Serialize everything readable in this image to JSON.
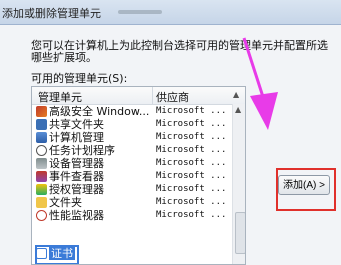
{
  "window": {
    "title": "添加或删除管理单元"
  },
  "description": {
    "line1": "您可以在计算机上为此控制台选择可用的管理单元并配置所选",
    "line2": "哪些扩展项。"
  },
  "available_label": "可用的管理单元(S):",
  "table": {
    "columns": [
      "管理单元",
      "供应商"
    ],
    "rows": [
      {
        "name": "高级安全 Window...",
        "vendor": "Microsoft ...",
        "icon": "firewall-icon"
      },
      {
        "name": "共享文件夹",
        "vendor": "Microsoft ...",
        "icon": "shared-folder-icon"
      },
      {
        "name": "计算机管理",
        "vendor": "Microsoft ...",
        "icon": "computer-management-icon"
      },
      {
        "name": "任务计划程序",
        "vendor": "Microsoft ...",
        "icon": "clock-icon"
      },
      {
        "name": "设备管理器",
        "vendor": "Microsoft ...",
        "icon": "device-manager-icon"
      },
      {
        "name": "事件查看器",
        "vendor": "Microsoft ...",
        "icon": "event-viewer-icon"
      },
      {
        "name": "授权管理器",
        "vendor": "Microsoft ...",
        "icon": "authorization-icon"
      },
      {
        "name": "文件夹",
        "vendor": "Microsoft ...",
        "icon": "folder-icon"
      },
      {
        "name": "性能监视器",
        "vendor": "Microsoft ...",
        "icon": "performance-icon"
      },
      {
        "name": "证书",
        "vendor": "",
        "icon": "certificate-icon",
        "selected": true
      }
    ]
  },
  "add_button": {
    "label": "添加(A) >"
  },
  "colors": {
    "highlight_red": "#e0302b",
    "arrow_magenta": "#e83be8",
    "selection_blue": "#3b7bd8"
  }
}
